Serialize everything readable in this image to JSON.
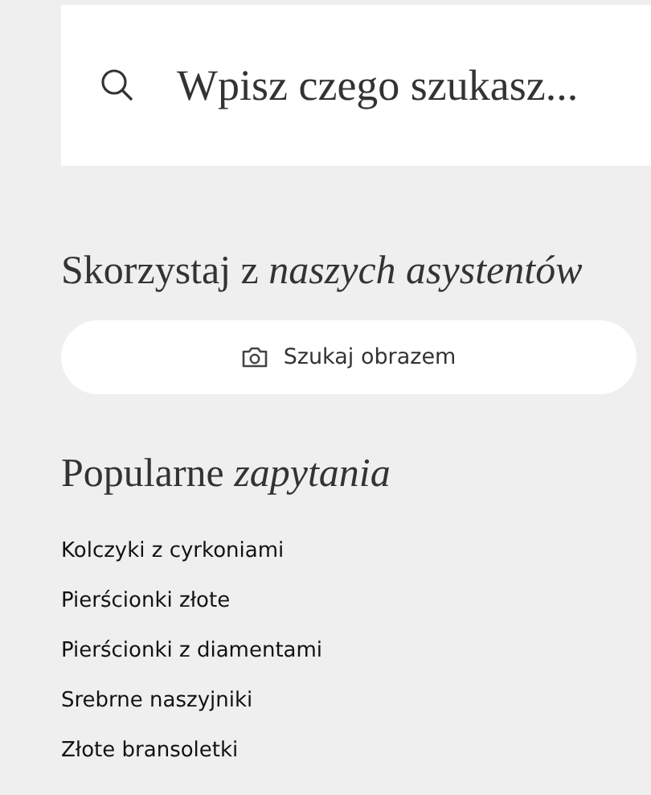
{
  "search": {
    "placeholder": "Wpisz czego szukasz..."
  },
  "assistants": {
    "heading": "Skorzystaj z *naszych asystentów*",
    "button": "Szukaj obrazem"
  },
  "popular": {
    "heading": "Popularne *zapytania*",
    "items": [
      "Kolczyki z cyrkoniami",
      "Pierścionki złote",
      "Pierścionki z diamentami",
      "Srebrne naszyjniki",
      "Złote bransoletki"
    ]
  }
}
